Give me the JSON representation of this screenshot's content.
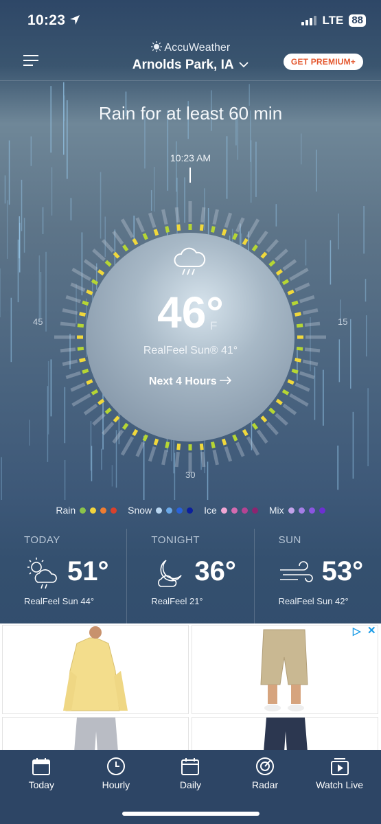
{
  "status_bar": {
    "time": "10:23",
    "network": "LTE",
    "battery": "88"
  },
  "header": {
    "brand": "AccuWeather",
    "location": "Arnolds Park, IA",
    "premium_label": "GET PREMIUM+"
  },
  "hero": {
    "headline": "Rain for at least 60 min",
    "ring_time": "10:23 AM",
    "ring_ticks": {
      "left": "45",
      "right": "15",
      "bottom": "30"
    },
    "condition_icon": "rain-cloud-icon",
    "temperature": "46°",
    "unit": "F",
    "realfeel": "RealFeel Sun® 41°",
    "next_hours": "Next 4 Hours"
  },
  "legend": {
    "rain": {
      "label": "Rain",
      "colors": [
        "#8bc34a",
        "#f2d43d",
        "#ef7d32",
        "#d9412c"
      ]
    },
    "snow": {
      "label": "Snow",
      "colors": [
        "#b9d6f0",
        "#6aa8e8",
        "#2a62d8",
        "#0b1f9e"
      ]
    },
    "ice": {
      "label": "Ice",
      "colors": [
        "#f1a7d4",
        "#d46bb0",
        "#b44393",
        "#8c2470"
      ]
    },
    "mix": {
      "label": "Mix",
      "colors": [
        "#c2a3ea",
        "#a47ee6",
        "#8a55e0",
        "#6c2fd1"
      ]
    }
  },
  "forecast": [
    {
      "label": "TODAY",
      "temp": "51°",
      "realfeel": "RealFeel Sun 44°",
      "icon": "partly-sunny-rain-icon"
    },
    {
      "label": "TONIGHT",
      "temp": "36°",
      "realfeel": "RealFeel 21°",
      "icon": "moon-cloud-icon"
    },
    {
      "label": "SUN",
      "temp": "53°",
      "realfeel": "RealFeel Sun 42°",
      "icon": "wind-icon"
    }
  ],
  "tabs": [
    {
      "label": "Today",
      "icon": "calendar-today-icon"
    },
    {
      "label": "Hourly",
      "icon": "clock-icon"
    },
    {
      "label": "Daily",
      "icon": "calendar-icon"
    },
    {
      "label": "Radar",
      "icon": "radar-icon"
    },
    {
      "label": "Watch Live",
      "icon": "play-video-icon"
    }
  ],
  "colors": {
    "background": "#2d4565",
    "premium_text": "#e4572e",
    "ring_green": "#b5d634",
    "ring_yellow": "#f0d83c"
  }
}
